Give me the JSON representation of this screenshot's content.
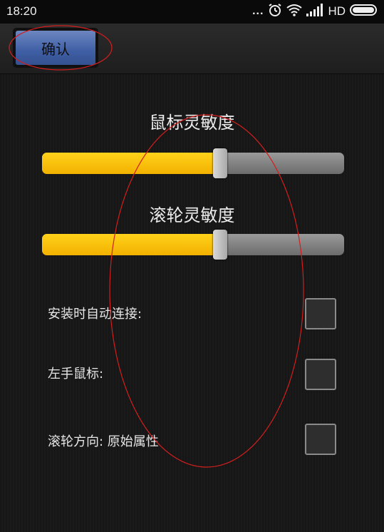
{
  "status_bar": {
    "time": "18:20",
    "more_indicator": "...",
    "network": "HD",
    "icons": [
      "alarm-icon",
      "wifi-icon",
      "signal-icon",
      "battery-icon"
    ]
  },
  "toolbar": {
    "confirm_label": "确认"
  },
  "settings": {
    "mouse_sensitivity": {
      "title": "鼠标灵敏度",
      "level": 0.59
    },
    "wheel_sensitivity": {
      "title": "滚轮灵敏度",
      "level": 0.59
    },
    "options": [
      {
        "label": "安装时自动连接:",
        "checked": false
      },
      {
        "label": "左手鼠标:",
        "checked": false
      },
      {
        "label": "滚轮方向: 原始属性",
        "checked": false
      }
    ]
  },
  "colors": {
    "accent": "#f5b800",
    "button": "#4a68aa",
    "background": "#151515",
    "annotation": "#d21e1e"
  }
}
